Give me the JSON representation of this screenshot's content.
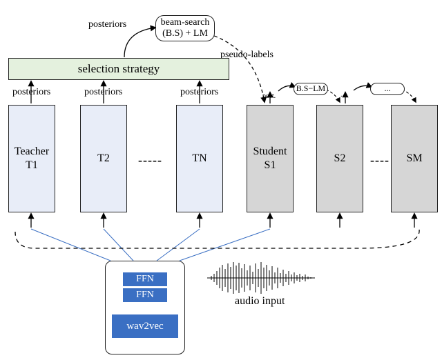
{
  "top": {
    "beam_search_line1": "beam-search",
    "beam_search_line2": "(B.S) + LM",
    "posteriors_top": "posteriors",
    "pseudo_labels": "pseudo-labels"
  },
  "selection_strategy": "selection strategy",
  "teacher_posteriors": [
    "posteriors",
    "posteriors",
    "posteriors"
  ],
  "teachers": {
    "t1_line1": "Teacher",
    "t1_line2": "T1",
    "t2": "T2",
    "dashes": "-----",
    "tn": "TN"
  },
  "students": {
    "s1_line1": "Student",
    "s1_line2": "S1",
    "s2": "S2",
    "dashes": "----",
    "sm": "SM"
  },
  "s1_top": {
    "post": "post.",
    "bslm": "B.S−LM"
  },
  "s2_top": {
    "ellipsis": "...",
    "box": "..."
  },
  "feature": {
    "ffn": "FFN",
    "wav2vec": "wav2vec"
  },
  "audio_input": "audio input"
}
